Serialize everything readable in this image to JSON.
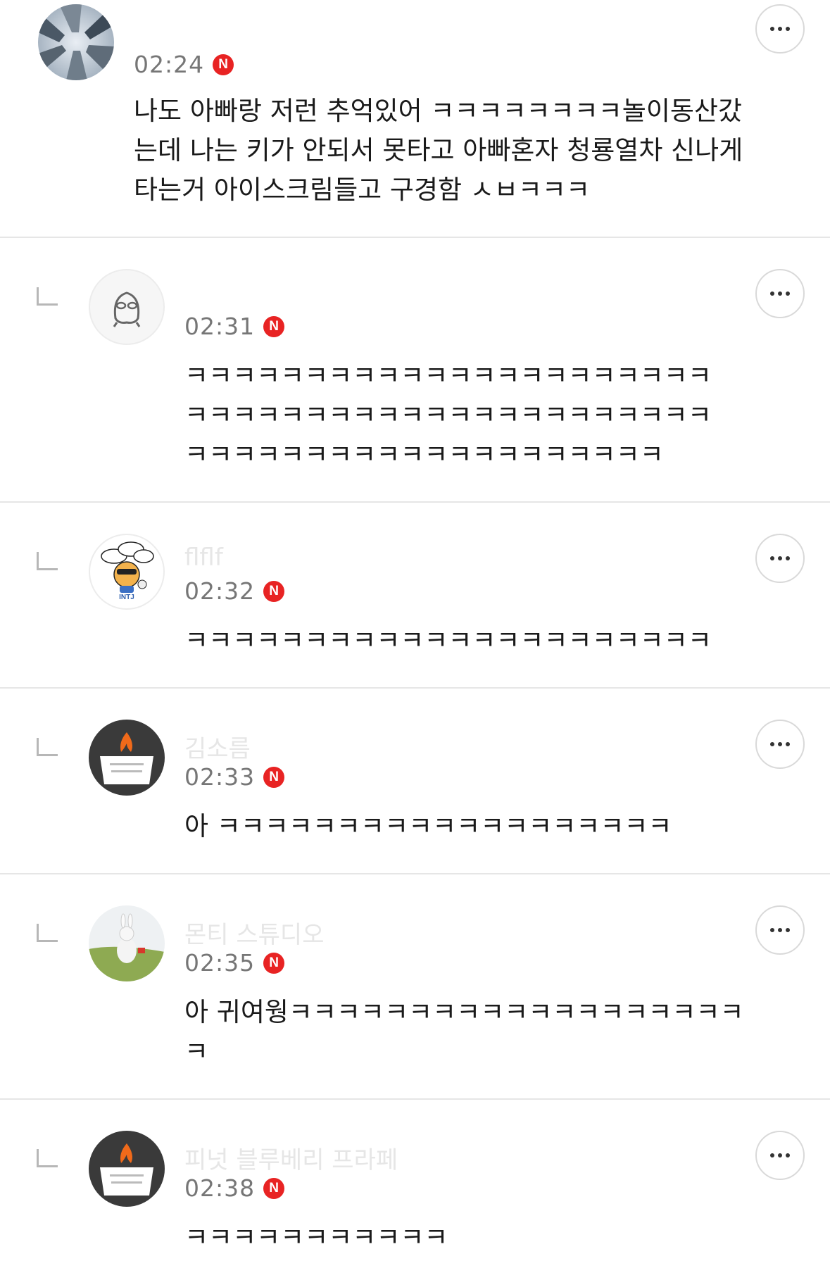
{
  "comments": [
    {
      "name": "",
      "time": "02:24",
      "badge": "N",
      "text": "나도 아빠랑 저런 추억있어 ㅋㅋㅋㅋㅋㅋㅋㅋ놀이동산갔\n는데 나는 키가 안되서 못타고 아빠혼자 청룡열차 신나게\n타는거 아이스크림들고 구경함 ㅅㅂㅋㅋㅋ",
      "avatar": "buildings-photo"
    },
    {
      "name": "",
      "time": "02:31",
      "badge": "N",
      "text": "ㅋㅋㅋㅋㅋㅋㅋㅋㅋㅋㅋㅋㅋㅋㅋㅋㅋㅋㅋㅋㅋㅋ\nㅋㅋㅋㅋㅋㅋㅋㅋㅋㅋㅋㅋㅋㅋㅋㅋㅋㅋㅋㅋㅋㅋ\nㅋㅋㅋㅋㅋㅋㅋㅋㅋㅋㅋㅋㅋㅋㅋㅋㅋㅋㅋㅋ",
      "avatar": "default-character"
    },
    {
      "name": "flflf",
      "time": "02:32",
      "badge": "N",
      "text": "ㅋㅋㅋㅋㅋㅋㅋㅋㅋㅋㅋㅋㅋㅋㅋㅋㅋㅋㅋㅋㅋㅋ",
      "avatar": "cartoon-sticker",
      "avatar_label": "INTJ"
    },
    {
      "name": "김소름",
      "time": "02:33",
      "badge": "N",
      "text": "아 ㅋㅋㅋㅋㅋㅋㅋㅋㅋㅋㅋㅋㅋㅋㅋㅋㅋㅋㅋ",
      "avatar": "candle-logo"
    },
    {
      "name": "몬티 스튜디오",
      "time": "02:35",
      "badge": "N",
      "text": "아 귀여웡ㅋㅋㅋㅋㅋㅋㅋㅋㅋㅋㅋㅋㅋㅋㅋㅋㅋㅋㅋ\nㅋ",
      "avatar": "bunny-photo"
    },
    {
      "name": "피넛 블루베리 프라페",
      "time": "02:38",
      "badge": "N",
      "text": "ㅋㅋㅋㅋㅋㅋㅋㅋㅋㅋㅋ",
      "avatar": "candle-logo"
    }
  ],
  "colors": {
    "badge": "#e82323",
    "time": "#767676",
    "name": "#e6e6e6",
    "divider": "#e6e6e6"
  }
}
